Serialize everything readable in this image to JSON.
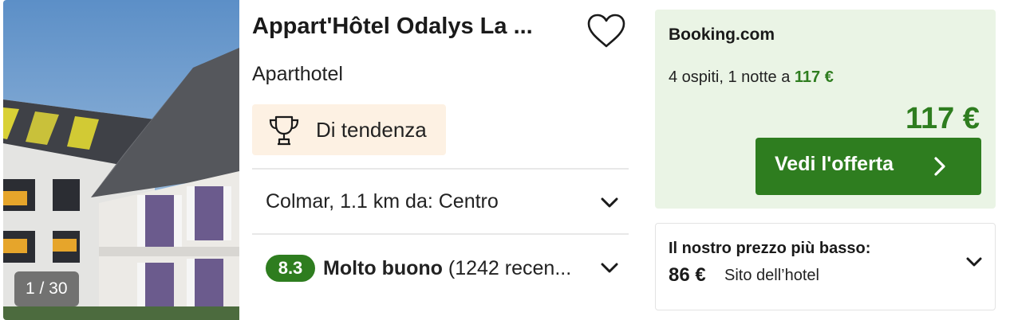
{
  "listing": {
    "title": "Appart'Hôtel Odalys La ...",
    "type": "Aparthotel",
    "photo_counter": "1 / 30",
    "trend_label": "Di tendenza",
    "location": "Colmar, 1.1 km da: Centro",
    "rating": {
      "score": "8.3",
      "label": "Molto buono",
      "reviews": " (1242 recen..."
    }
  },
  "offer": {
    "provider": "Booking.com",
    "guests_prefix": "4 ospiti, 1 notte a ",
    "guests_price": "117 €",
    "price": "117 €",
    "cta_label": "Vedi l'offerta"
  },
  "lowest": {
    "label": "Il nostro prezzo più basso:",
    "price": "86 €",
    "source": "Sito dell’hotel"
  },
  "colors": {
    "accent_green": "#2e7d1f",
    "offer_bg": "#eaf4e5",
    "trend_bg": "#fdf1e3"
  },
  "icons": [
    "heart-icon",
    "trophy-icon",
    "chevron-down-icon",
    "chevron-right-icon"
  ]
}
